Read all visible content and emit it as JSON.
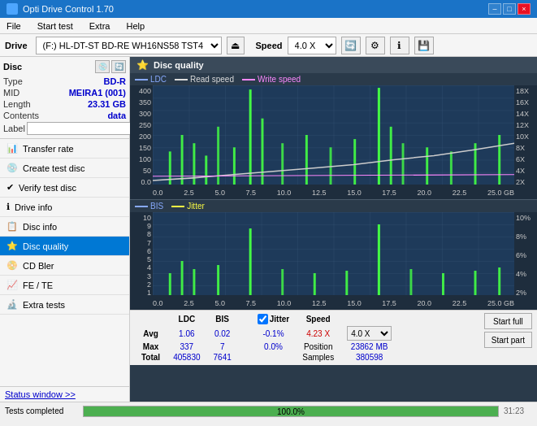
{
  "app": {
    "title": "Opti Drive Control 1.70",
    "icon": "disc-icon"
  },
  "titlebar": {
    "minimize": "–",
    "maximize": "□",
    "close": "×"
  },
  "menu": {
    "items": [
      "File",
      "Start test",
      "Extra",
      "Help"
    ]
  },
  "drive_toolbar": {
    "drive_label": "Drive",
    "drive_value": "(F:)  HL-DT-ST BD-RE  WH16NS58 TST4",
    "speed_label": "Speed",
    "speed_value": "4.0 X"
  },
  "disc": {
    "title": "Disc",
    "type_label": "Type",
    "type_value": "BD-R",
    "mid_label": "MID",
    "mid_value": "MEIRA1 (001)",
    "length_label": "Length",
    "length_value": "23.31 GB",
    "contents_label": "Contents",
    "contents_value": "data",
    "label_label": "Label",
    "label_value": ""
  },
  "nav": {
    "items": [
      {
        "id": "transfer-rate",
        "label": "Transfer rate",
        "icon": "📊",
        "active": false
      },
      {
        "id": "create-test-disc",
        "label": "Create test disc",
        "icon": "💿",
        "active": false
      },
      {
        "id": "verify-test-disc",
        "label": "Verify test disc",
        "icon": "✔",
        "active": false
      },
      {
        "id": "drive-info",
        "label": "Drive info",
        "icon": "ℹ",
        "active": false
      },
      {
        "id": "disc-info",
        "label": "Disc info",
        "icon": "📋",
        "active": false
      },
      {
        "id": "disc-quality",
        "label": "Disc quality",
        "icon": "⭐",
        "active": true
      },
      {
        "id": "cd-bler",
        "label": "CD Bler",
        "icon": "📀",
        "active": false
      },
      {
        "id": "fe-te",
        "label": "FE / TE",
        "icon": "📈",
        "active": false
      },
      {
        "id": "extra-tests",
        "label": "Extra tests",
        "icon": "🔬",
        "active": false
      }
    ]
  },
  "chart_quality": {
    "title": "Disc quality",
    "legend": {
      "ldc": "LDC",
      "read_speed": "Read speed",
      "write_speed": "Write speed"
    },
    "y_axis_left": [
      "400",
      "350",
      "300",
      "250",
      "200",
      "150",
      "100",
      "50",
      "0.0"
    ],
    "y_axis_right": [
      "18X",
      "16X",
      "14X",
      "12X",
      "10X",
      "8X",
      "6X",
      "4X",
      "2X"
    ],
    "x_axis": [
      "0.0",
      "2.5",
      "5.0",
      "7.5",
      "10.0",
      "12.5",
      "15.0",
      "17.5",
      "20.0",
      "22.5",
      "25.0 GB"
    ]
  },
  "chart_bis": {
    "legend": {
      "bis": "BIS",
      "jitter": "Jitter"
    },
    "y_axis_left": [
      "10",
      "9",
      "8",
      "7",
      "6",
      "5",
      "4",
      "3",
      "2",
      "1"
    ],
    "y_axis_right": [
      "10%",
      "8%",
      "6%",
      "4%",
      "2%"
    ],
    "x_axis": [
      "0.0",
      "2.5",
      "5.0",
      "7.5",
      "10.0",
      "12.5",
      "15.0",
      "17.5",
      "20.0",
      "22.5",
      "25.0 GB"
    ]
  },
  "stats": {
    "headers": [
      "",
      "LDC",
      "BIS",
      "",
      "Jitter",
      "Speed",
      ""
    ],
    "avg_label": "Avg",
    "avg_ldc": "1.06",
    "avg_bis": "0.02",
    "avg_jitter": "-0.1%",
    "avg_speed": "",
    "max_label": "Max",
    "max_ldc": "337",
    "max_bis": "7",
    "max_jitter": "0.0%",
    "total_label": "Total",
    "total_ldc": "405830",
    "total_bis": "7641",
    "speed_val": "4.23 X",
    "speed_select": "4.0 X",
    "position_label": "Position",
    "position_val": "23862 MB",
    "samples_label": "Samples",
    "samples_val": "380598",
    "jitter_checked": true,
    "jitter_label": "Jitter"
  },
  "buttons": {
    "start_full": "Start full",
    "start_part": "Start part"
  },
  "status": {
    "window_btn": "Status window >>",
    "status_text": "Tests completed",
    "progress": 100,
    "progress_pct": "100.0%",
    "time": "31:23"
  }
}
